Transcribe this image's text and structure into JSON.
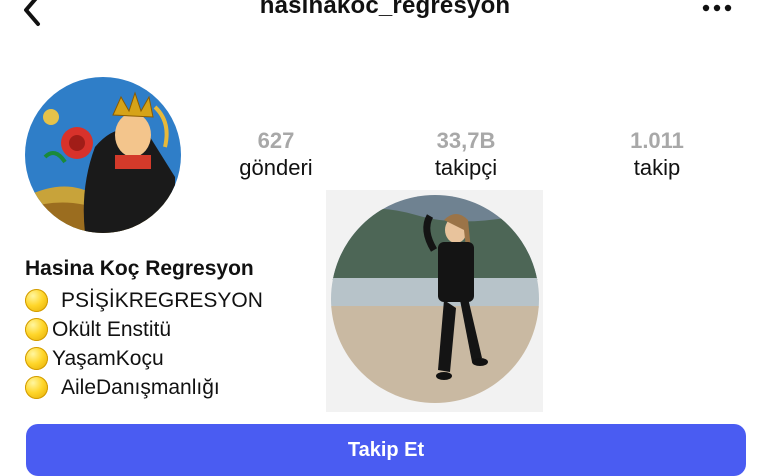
{
  "header": {
    "username": "hasinakoc_regresyon",
    "back_icon": "chevron-left-icon",
    "more_icon": "more-horizontal-icon"
  },
  "stats": {
    "posts": {
      "value": "627",
      "label": "gönderi"
    },
    "followers": {
      "value": "33,7B",
      "label": "takipçi"
    },
    "following": {
      "value": "1.011",
      "label": "takip"
    }
  },
  "bio": {
    "name": "Hasina Koç Regresyon",
    "lines": [
      "PSİŞİKREGRESYON",
      "Okült Enstitü",
      "YaşamKoçu",
      "AileDanışmanlığı"
    ],
    "bullet_icon": "yellow-circle-emoji"
  },
  "actions": {
    "follow_label": "Takip Et",
    "follow_color": "#4a5cf2"
  }
}
